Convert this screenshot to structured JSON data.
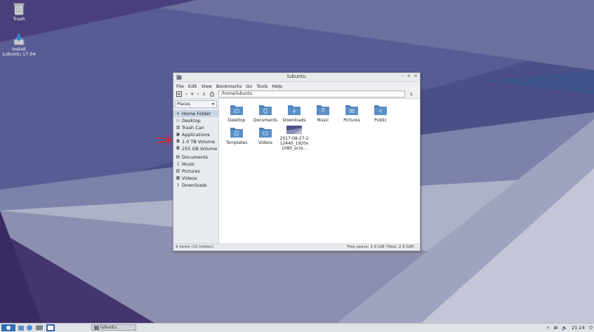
{
  "desktop": {
    "icons": [
      {
        "label": "Trash",
        "icon": "trash-icon"
      },
      {
        "label_line1": "Install",
        "label_line2": "Lubuntu 17.04",
        "icon": "install-icon"
      }
    ]
  },
  "window": {
    "title": "lubuntu",
    "controls": [
      "–",
      "+",
      "×"
    ],
    "menu": [
      "File",
      "Edit",
      "View",
      "Bookmarks",
      "Go",
      "Tools",
      "Help"
    ],
    "path": "/home/lubuntu",
    "sidebar": {
      "selector": "Places",
      "items": [
        {
          "label": "Home Folder",
          "icon": "home-icon",
          "selected": true
        },
        {
          "label": "Desktop",
          "icon": "desktop-icon"
        },
        {
          "label": "Trash Can",
          "icon": "trash-icon"
        },
        {
          "label": "Applications",
          "icon": "applications-icon"
        },
        {
          "label": "1.0 TB Volume",
          "icon": "drive-icon"
        },
        {
          "label": "255 GB Volume",
          "icon": "drive-icon"
        },
        {
          "label": "Documents",
          "icon": "folder-icon"
        },
        {
          "label": "Music",
          "icon": "music-icon"
        },
        {
          "label": "Pictures",
          "icon": "pictures-icon"
        },
        {
          "label": "Videos",
          "icon": "videos-icon"
        },
        {
          "label": "Downloads",
          "icon": "downloads-icon"
        }
      ]
    },
    "files": [
      {
        "name": "Desktop",
        "icon": "folder-desktop-icon"
      },
      {
        "name": "Documents",
        "icon": "folder-documents-icon"
      },
      {
        "name": "Downloads",
        "icon": "folder-downloads-icon"
      },
      {
        "name": "Music",
        "icon": "folder-music-icon"
      },
      {
        "name": "Pictures",
        "icon": "folder-pictures-icon"
      },
      {
        "name": "Public",
        "icon": "folder-public-icon"
      },
      {
        "name": "Templates",
        "icon": "folder-templates-icon"
      },
      {
        "name": "Videos",
        "icon": "folder-videos-icon"
      },
      {
        "name_line1": "2017-08-27-2",
        "name_line2": "12440_1920x",
        "name_line3": "1080_scro...",
        "icon": "image-thumbnail-icon"
      }
    ],
    "status": {
      "left": "9 items (10 hidden)",
      "right": "Free space: 2.9 GiB (Total: 2.9 GiB)"
    }
  },
  "taskbar": {
    "task": "lubuntu",
    "clock": "21:24"
  },
  "colors": {
    "folder": "#5b8fc7",
    "annotation_arrow": "#e02020",
    "selection": "#c9d4e4"
  }
}
